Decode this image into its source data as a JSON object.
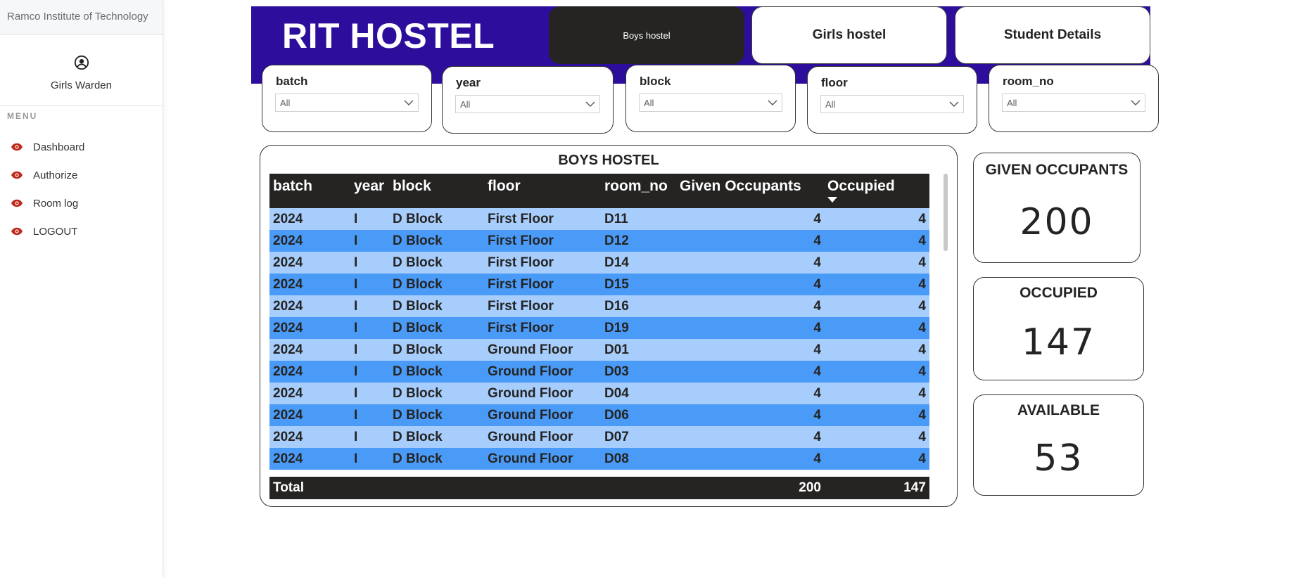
{
  "sidebar": {
    "brand": "Ramco Institute of Technology",
    "user_icon": "user-circle-icon",
    "user_name": "Girls Warden",
    "menu_title": "MENU",
    "menu_icon": "eye-icon",
    "accent": "#c0281c",
    "items": [
      {
        "label": "Dashboard"
      },
      {
        "label": "Authorize"
      },
      {
        "label": "Room log"
      },
      {
        "label": "LOGOUT"
      }
    ]
  },
  "header": {
    "title": "RIT HOSTEL",
    "background": "#2d0d9c",
    "nav": [
      {
        "label": "Boys hostel",
        "active": true
      },
      {
        "label": "Girls hostel",
        "active": false
      },
      {
        "label": "Student Details",
        "active": false
      }
    ]
  },
  "filters": [
    {
      "label": "batch",
      "value": "All"
    },
    {
      "label": "year",
      "value": "All"
    },
    {
      "label": "block",
      "value": "All"
    },
    {
      "label": "floor",
      "value": "All"
    },
    {
      "label": "room_no",
      "value": "All"
    }
  ],
  "table": {
    "title": "BOYS HOSTEL",
    "columns": [
      "batch",
      "year",
      "block",
      "floor",
      "room_no",
      "Given Occupants",
      "Occupied"
    ],
    "sorted_column": "Occupied",
    "row_colors": [
      "#a6cdfb",
      "#4a9bf7"
    ],
    "rows": [
      [
        "2024",
        "I",
        "D Block",
        "First Floor",
        "D11",
        "4",
        "4"
      ],
      [
        "2024",
        "I",
        "D Block",
        "First Floor",
        "D12",
        "4",
        "4"
      ],
      [
        "2024",
        "I",
        "D Block",
        "First Floor",
        "D14",
        "4",
        "4"
      ],
      [
        "2024",
        "I",
        "D Block",
        "First Floor",
        "D15",
        "4",
        "4"
      ],
      [
        "2024",
        "I",
        "D Block",
        "First Floor",
        "D16",
        "4",
        "4"
      ],
      [
        "2024",
        "I",
        "D Block",
        "First Floor",
        "D19",
        "4",
        "4"
      ],
      [
        "2024",
        "I",
        "D Block",
        "Ground Floor",
        "D01",
        "4",
        "4"
      ],
      [
        "2024",
        "I",
        "D Block",
        "Ground Floor",
        "D03",
        "4",
        "4"
      ],
      [
        "2024",
        "I",
        "D Block",
        "Ground Floor",
        "D04",
        "4",
        "4"
      ],
      [
        "2024",
        "I",
        "D Block",
        "Ground Floor",
        "D06",
        "4",
        "4"
      ],
      [
        "2024",
        "I",
        "D Block",
        "Ground Floor",
        "D07",
        "4",
        "4"
      ],
      [
        "2024",
        "I",
        "D Block",
        "Ground Floor",
        "D08",
        "4",
        "4"
      ]
    ],
    "total": {
      "label": "Total",
      "given": "200",
      "occupied": "147"
    }
  },
  "kpis": [
    {
      "label": "GIVEN OCCUPANTS",
      "value": "200"
    },
    {
      "label": "OCCUPIED",
      "value": "147"
    },
    {
      "label": "AVAILABLE",
      "value": "53"
    }
  ]
}
